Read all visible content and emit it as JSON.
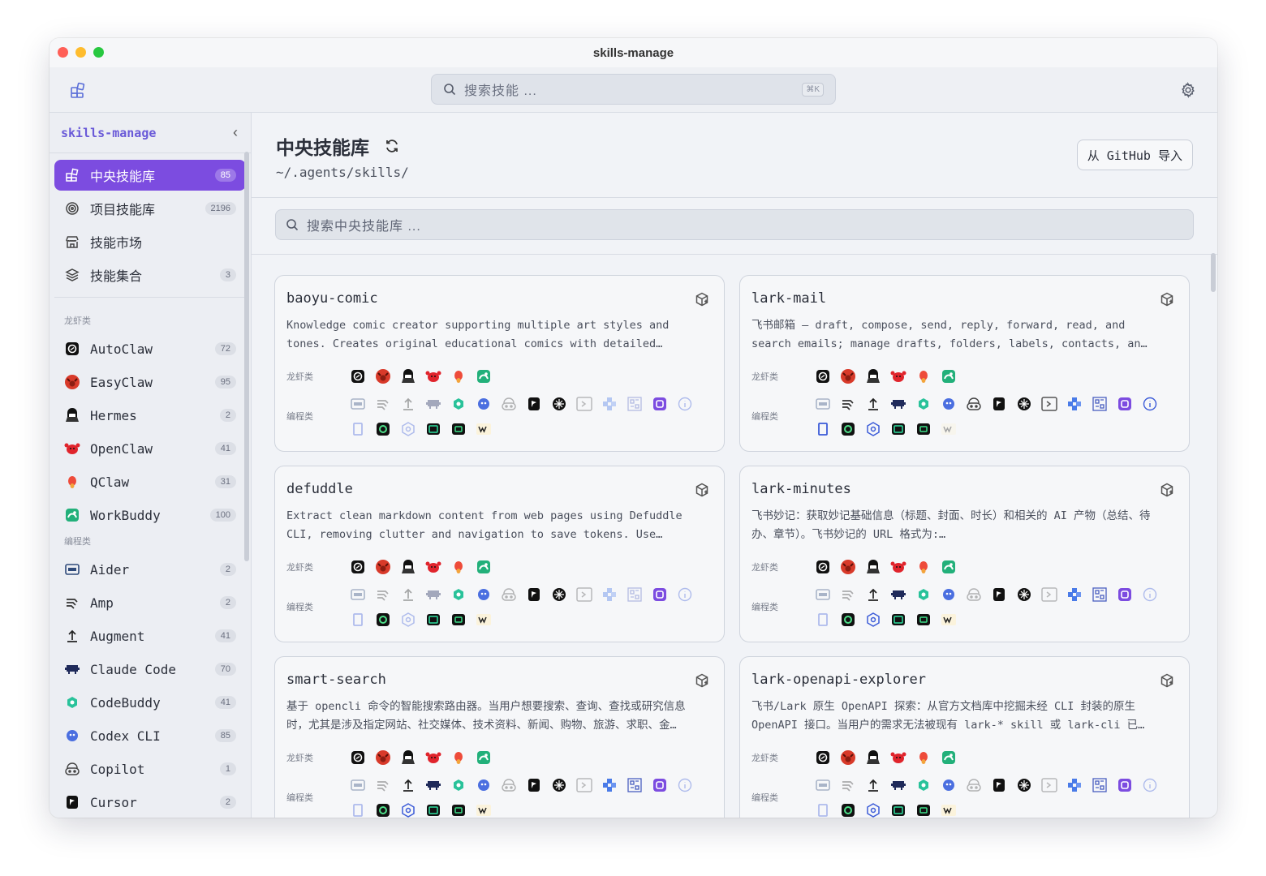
{
  "window": {
    "title": "skills-manage"
  },
  "toolbar": {
    "search_placeholder": "搜索技能 ...",
    "shortcut": "⌘K"
  },
  "sidebar": {
    "brand": "skills-manage",
    "collapse_icon": "chevron-left-icon",
    "nav": [
      {
        "label": "中央技能库",
        "count": "85",
        "icon": "grid-icon",
        "active": true
      },
      {
        "label": "项目技能库",
        "count": "2196",
        "icon": "target-icon"
      },
      {
        "label": "技能市场",
        "count": "",
        "icon": "store-icon"
      },
      {
        "label": "技能集合",
        "count": "3",
        "icon": "layers-icon"
      }
    ],
    "group_claw": "龙虾类",
    "claw_items": [
      {
        "label": "AutoClaw",
        "count": "72"
      },
      {
        "label": "EasyClaw",
        "count": "95"
      },
      {
        "label": "Hermes",
        "count": "2"
      },
      {
        "label": "OpenClaw",
        "count": "41"
      },
      {
        "label": "QClaw",
        "count": "31"
      },
      {
        "label": "WorkBuddy",
        "count": "100"
      }
    ],
    "group_code": "编程类",
    "code_items": [
      {
        "label": "Aider",
        "count": "2"
      },
      {
        "label": "Amp",
        "count": "2"
      },
      {
        "label": "Augment",
        "count": "41"
      },
      {
        "label": "Claude Code",
        "count": "70"
      },
      {
        "label": "CodeBuddy",
        "count": "41"
      },
      {
        "label": "Codex CLI",
        "count": "85"
      },
      {
        "label": "Copilot",
        "count": "1"
      },
      {
        "label": "Cursor",
        "count": "2"
      }
    ]
  },
  "main": {
    "title": "中央技能库",
    "path": "~/.agents/skills/",
    "github_button": "从 GitHub 导入",
    "search_placeholder": "搜索中央技能库 ...",
    "row_label_claw": "龙虾类",
    "row_label_code": "编程类"
  },
  "cards": [
    {
      "name": "baoyu-comic",
      "d1": "Knowledge comic creator supporting multiple art styles and",
      "d2": "tones. Creates original educational comics with detailed…",
      "code_on": [
        false,
        false,
        false,
        false,
        true,
        true,
        false,
        true,
        true,
        false,
        false,
        false,
        true,
        false,
        false,
        true,
        false,
        true,
        true,
        true
      ]
    },
    {
      "name": "lark-mail",
      "d1": "飞书邮箱 — draft, compose, send, reply, forward, read, and",
      "d2": "search emails; manage drafts, folders, labels, contacts, an…",
      "code_on": [
        false,
        true,
        true,
        true,
        true,
        true,
        true,
        true,
        true,
        true,
        true,
        true,
        true,
        true,
        true,
        true,
        true,
        true,
        true,
        false
      ]
    },
    {
      "name": "defuddle",
      "d1": "Extract clean markdown content from web pages using Defuddle",
      "d2": "CLI, removing clutter and navigation to save tokens. Use…",
      "code_on": [
        false,
        false,
        false,
        false,
        true,
        true,
        false,
        true,
        true,
        false,
        false,
        false,
        true,
        false,
        false,
        true,
        false,
        true,
        true,
        true
      ]
    },
    {
      "name": "lark-minutes",
      "d1": "飞书妙记：获取妙记基础信息（标题、封面、时长）和相关的 AI 产物（总结、待",
      "d2": "办、章节）。飞书妙记的 URL 格式为:…",
      "code_on": [
        false,
        false,
        true,
        true,
        true,
        true,
        false,
        true,
        true,
        false,
        true,
        true,
        true,
        false,
        false,
        true,
        true,
        true,
        true,
        true
      ]
    },
    {
      "name": "smart-search",
      "d1": "基于 opencli 命令的智能搜索路由器。当用户想要搜索、查询、查找或研究信息",
      "d2": "时，尤其是涉及指定网站、社交媒体、技术资料、新闻、购物、旅游、求职、金…",
      "code_on": [
        false,
        false,
        true,
        true,
        true,
        true,
        false,
        true,
        true,
        false,
        true,
        true,
        true,
        false,
        false,
        true,
        true,
        true,
        true,
        true
      ]
    },
    {
      "name": "lark-openapi-explorer",
      "d1": "飞书/Lark 原生 OpenAPI 探索：从官方文档库中挖掘未经 CLI 封装的原生",
      "d2": "OpenAPI 接口。当用户的需求无法被现有 lark-* skill 或 lark-cli 已…",
      "code_on": [
        false,
        false,
        true,
        true,
        true,
        true,
        false,
        true,
        true,
        false,
        true,
        true,
        true,
        false,
        false,
        true,
        true,
        true,
        true,
        true
      ]
    }
  ]
}
